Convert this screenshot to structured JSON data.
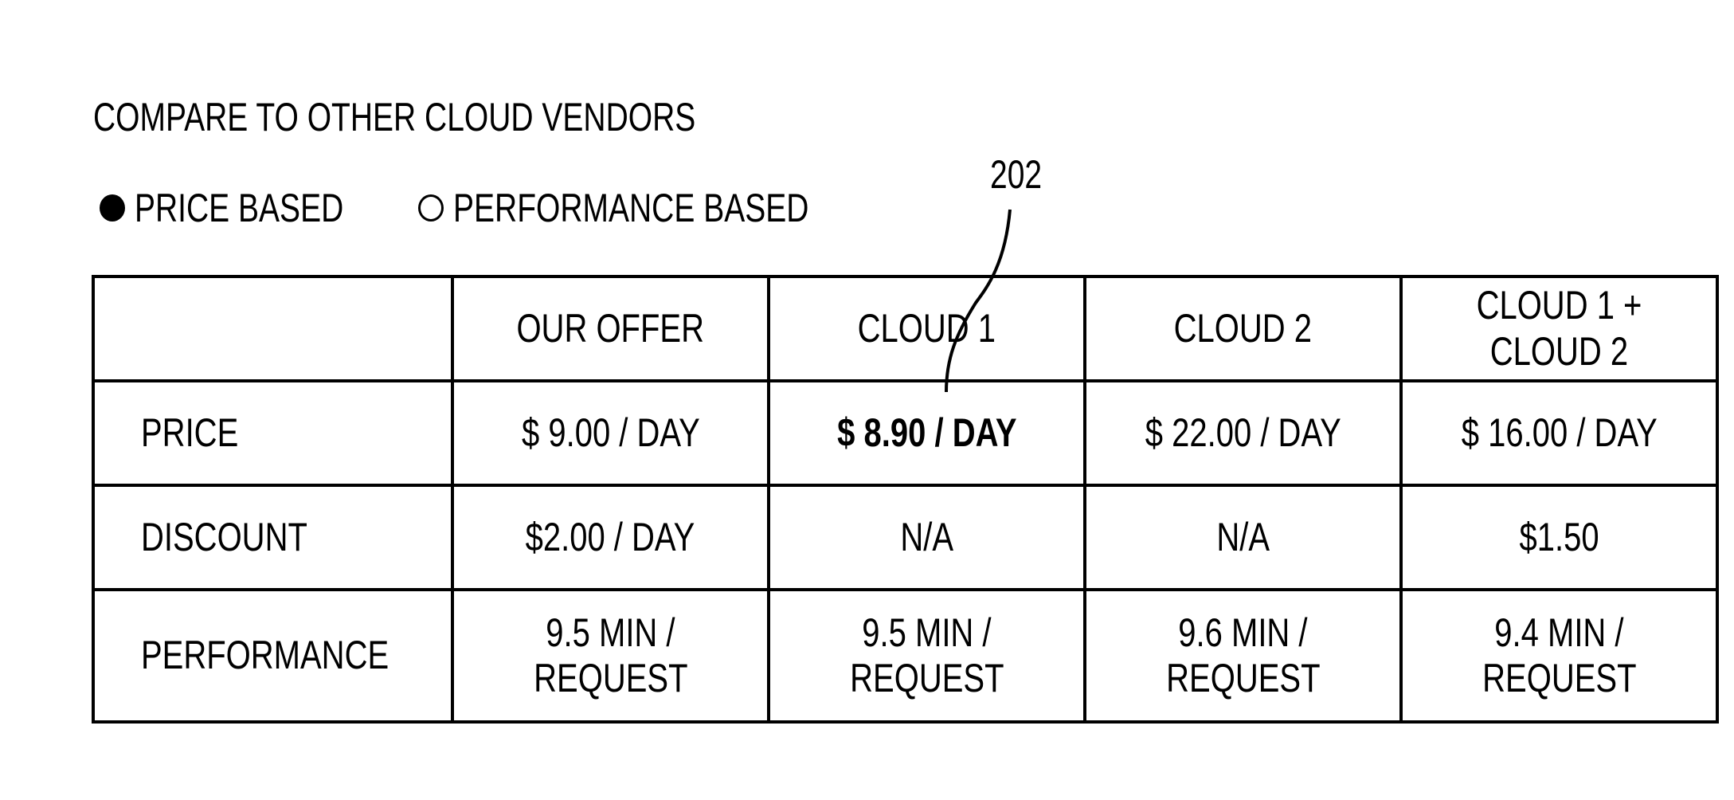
{
  "title": "COMPARE TO OTHER CLOUD VENDORS",
  "mode_options": [
    {
      "label": "PRICE BASED",
      "selected": true
    },
    {
      "label": "PERFORMANCE BASED",
      "selected": false
    }
  ],
  "reference_numeral": "202",
  "table": {
    "columns": [
      "",
      "OUR OFFER",
      "CLOUD 1",
      "CLOUD 2",
      "CLOUD 1 + CLOUD 2"
    ],
    "rows": [
      {
        "label": "PRICE",
        "cells": [
          "$ 9.00 / DAY",
          "$ 8.90 / DAY",
          "$ 22.00 / DAY",
          "$ 16.00 / DAY"
        ],
        "highlight_index": 1
      },
      {
        "label": "DISCOUNT",
        "cells": [
          "$2.00 / DAY",
          "N/A",
          "N/A",
          "$1.50"
        ]
      },
      {
        "label": "PERFORMANCE",
        "cells": [
          [
            "9.5 MIN /",
            "REQUEST"
          ],
          [
            "9.5 MIN /",
            "REQUEST"
          ],
          [
            "9.6 MIN /",
            "REQUEST"
          ],
          [
            "9.4 MIN /",
            "REQUEST"
          ]
        ]
      }
    ]
  }
}
